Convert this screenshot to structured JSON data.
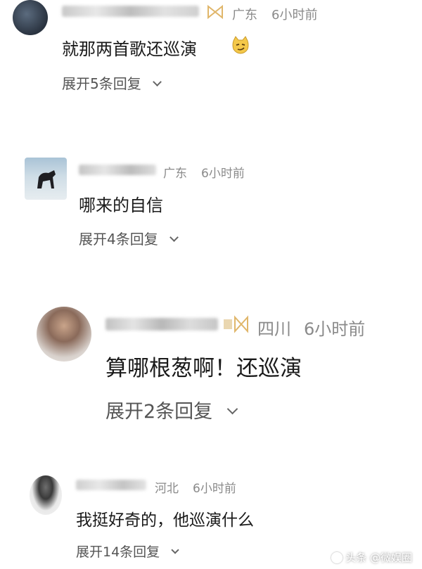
{
  "comments": [
    {
      "region": "广东",
      "time": "6小时前",
      "text": "就那两首歌还巡演",
      "emoji_icon": "smirk-cat-emoji-icon",
      "expand_label": "展开5条回复"
    },
    {
      "region": "广东",
      "time": "6小时前",
      "text": "哪来的自信",
      "expand_label": "展开4条回复"
    },
    {
      "region": "四川",
      "time": "6小时前",
      "text": "算哪根葱啊！还巡演",
      "expand_label": "展开2条回复"
    },
    {
      "region": "河北",
      "time": "6小时前",
      "text": "我挺好奇的，他巡演什么",
      "expand_label": "展开14条回复"
    }
  ],
  "watermark": {
    "label": "头条 @微娱圈"
  },
  "colors": {
    "badge_gold": "#e0b66a",
    "meta_gray": "#8a8a8a"
  }
}
